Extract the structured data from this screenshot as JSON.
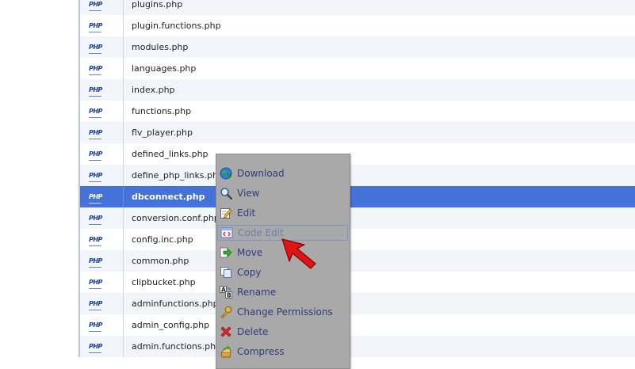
{
  "files": [
    "plugins.php",
    "plugin.functions.php",
    "modules.php",
    "languages.php",
    "index.php",
    "functions.php",
    "flv_player.php",
    "defined_links.php",
    "define_php_links.php",
    "dbconnect.php",
    "conversion.conf.php",
    "config.inc.php",
    "common.php",
    "clipbucket.php",
    "adminfunctions.php",
    "admin_config.php",
    "admin.functions.php"
  ],
  "file_icon_label": "PHP",
  "selected_file": "dbconnect.php",
  "context_menu": {
    "items": [
      {
        "label": "Download",
        "icon": "globe-download-icon"
      },
      {
        "label": "View",
        "icon": "magnifier-icon"
      },
      {
        "label": "Edit",
        "icon": "pencil-edit-icon"
      },
      {
        "label": "Code Edit",
        "icon": "code-edit-icon"
      },
      {
        "label": "Move",
        "icon": "green-arrow-icon"
      },
      {
        "label": "Copy",
        "icon": "copy-pages-icon"
      },
      {
        "label": "Rename",
        "icon": "ab-rename-icon"
      },
      {
        "label": "Change Permissions",
        "icon": "key-icon"
      },
      {
        "label": "Delete",
        "icon": "red-x-icon"
      },
      {
        "label": "Compress",
        "icon": "compress-icon"
      }
    ],
    "highlighted_item": "Code Edit"
  },
  "colors": {
    "selected_row": "#4472d8",
    "menu_background": "#a9a9a9",
    "menu_text": "#2e3c7a",
    "pointer_arrow": "#e01414"
  }
}
